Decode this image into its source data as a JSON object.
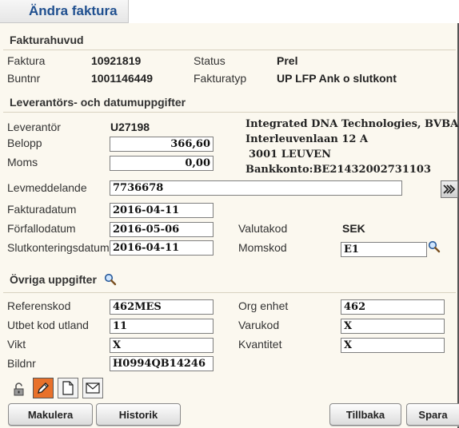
{
  "title": "Ändra faktura",
  "header": {
    "section_title": "Fakturahuvud",
    "faktura_label": "Faktura",
    "faktura_value": "10921819",
    "status_label": "Status",
    "status_value": "Prel",
    "buntnr_label": "Buntnr",
    "buntnr_value": "1001146449",
    "fakturatyp_label": "Fakturatyp",
    "fakturatyp_value": "UP LFP Ank o slutkont"
  },
  "supplier": {
    "section_title": "Leverantörs- och datumuppgifter",
    "leverantor_label": "Leverantör",
    "leverantor_value": "U27198",
    "belopp_label": "Belopp",
    "belopp_value": "366,60",
    "moms_label": "Moms",
    "moms_value": "0,00",
    "name": "Integrated DNA Technologies, BVBA",
    "address_line1": "Interleuvenlaan 12 A",
    "address_line2": "3001 LEUVEN",
    "bank_account": "Bankkonto:BE21432002731103",
    "levmeddelande_label": "Levmeddelande",
    "levmeddelande_value": "7736678",
    "fakturadatum_label": "Fakturadatum",
    "fakturadatum_value": "2016-04-11",
    "forfallodatum_label": "Förfallodatum",
    "forfallodatum_value": "2016-05-06",
    "slutkonteringsdatum_label": "Slutkonteringsdatum",
    "slutkonteringsdatum_value": "2016-04-11",
    "valutakod_label": "Valutakod",
    "valutakod_value": "SEK",
    "momskod_label": "Momskod",
    "momskod_value": "E1"
  },
  "other": {
    "section_title": "Övriga uppgifter",
    "referenskod_label": "Referenskod",
    "referenskod_value": "462MES",
    "org_enhet_label": "Org enhet",
    "org_enhet_value": "462",
    "utbet_label": "Utbet kod utland",
    "utbet_value": "11",
    "varukod_label": "Varukod",
    "varukod_value": "X",
    "vikt_label": "Vikt",
    "vikt_value": "X",
    "kvantitet_label": "Kvantitet",
    "kvantitet_value": "X",
    "bildnr_label": "Bildnr",
    "bildnr_value": "H0994QB14246"
  },
  "buttons": {
    "makulera": "Makulera",
    "historik": "Historik",
    "tillbaka": "Tillbaka",
    "spara": "Spara"
  },
  "icons": {
    "unlock": "unlock-icon",
    "edit": "pencil-icon",
    "document": "document-icon",
    "mail": "envelope-icon",
    "search": "magnifier-icon",
    "expand": "double-chevron-icon"
  },
  "colors": {
    "title": "#1f4f8f",
    "panel_bg": "#fbf8ef",
    "edit_button": "#e8712a"
  }
}
